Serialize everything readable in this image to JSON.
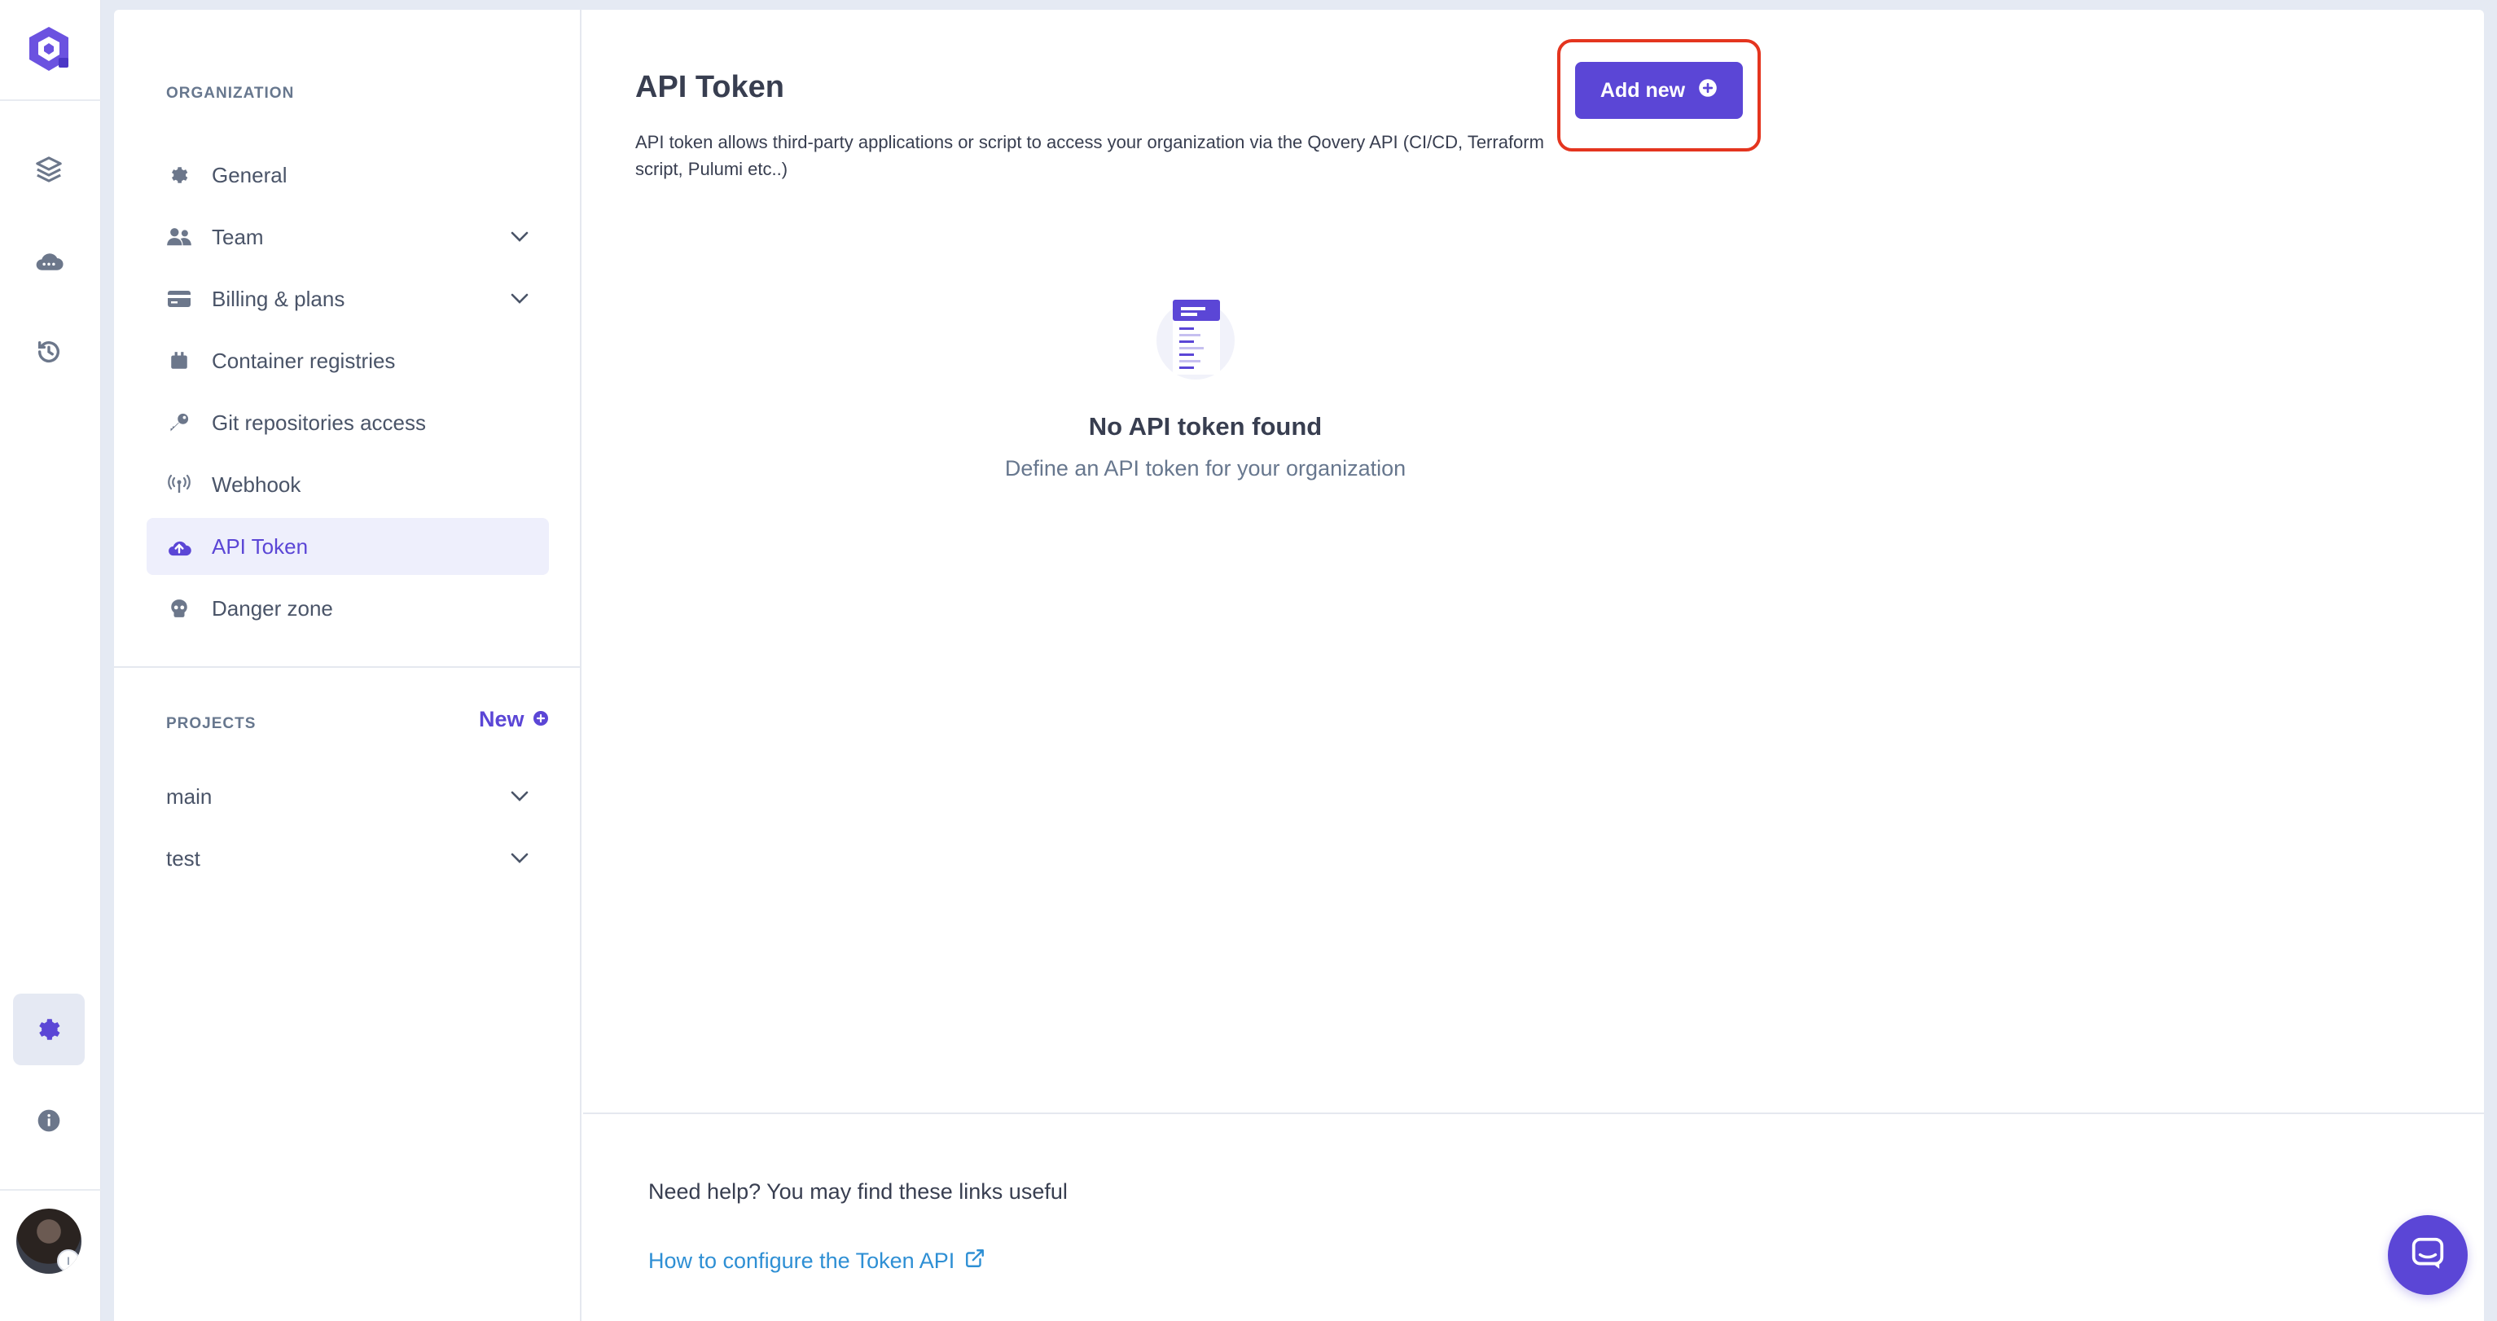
{
  "sidebar": {
    "organization_title": "ORGANIZATION",
    "items": [
      {
        "label": "General",
        "icon": "gear-icon"
      },
      {
        "label": "Team",
        "icon": "users-icon"
      },
      {
        "label": "Billing & plans",
        "icon": "credit-card-icon"
      },
      {
        "label": "Container registries",
        "icon": "box-icon"
      },
      {
        "label": "Git repositories access",
        "icon": "key-icon"
      },
      {
        "label": "Webhook",
        "icon": "broadcast-icon"
      },
      {
        "label": "API Token",
        "icon": "cloud-upload-icon",
        "active": true
      },
      {
        "label": "Danger zone",
        "icon": "skull-icon"
      }
    ],
    "projects_title": "PROJECTS",
    "new_label": "New",
    "projects": [
      {
        "label": "main"
      },
      {
        "label": "test"
      }
    ]
  },
  "content": {
    "title": "API Token",
    "description": "API token allows third-party applications or script to access your organization via the Qovery API (CI/CD, Terraform script, Pulumi etc..)",
    "add_button_label": "Add new",
    "empty_title": "No API token found",
    "empty_subtitle": "Define an API token for your organization",
    "help_title": "Need help? You may find these links useful",
    "help_link": "How to configure the Token API"
  },
  "colors": {
    "accent": "#5b46d6",
    "link": "#2e8fd4",
    "highlight_outline": "#e4351f"
  }
}
